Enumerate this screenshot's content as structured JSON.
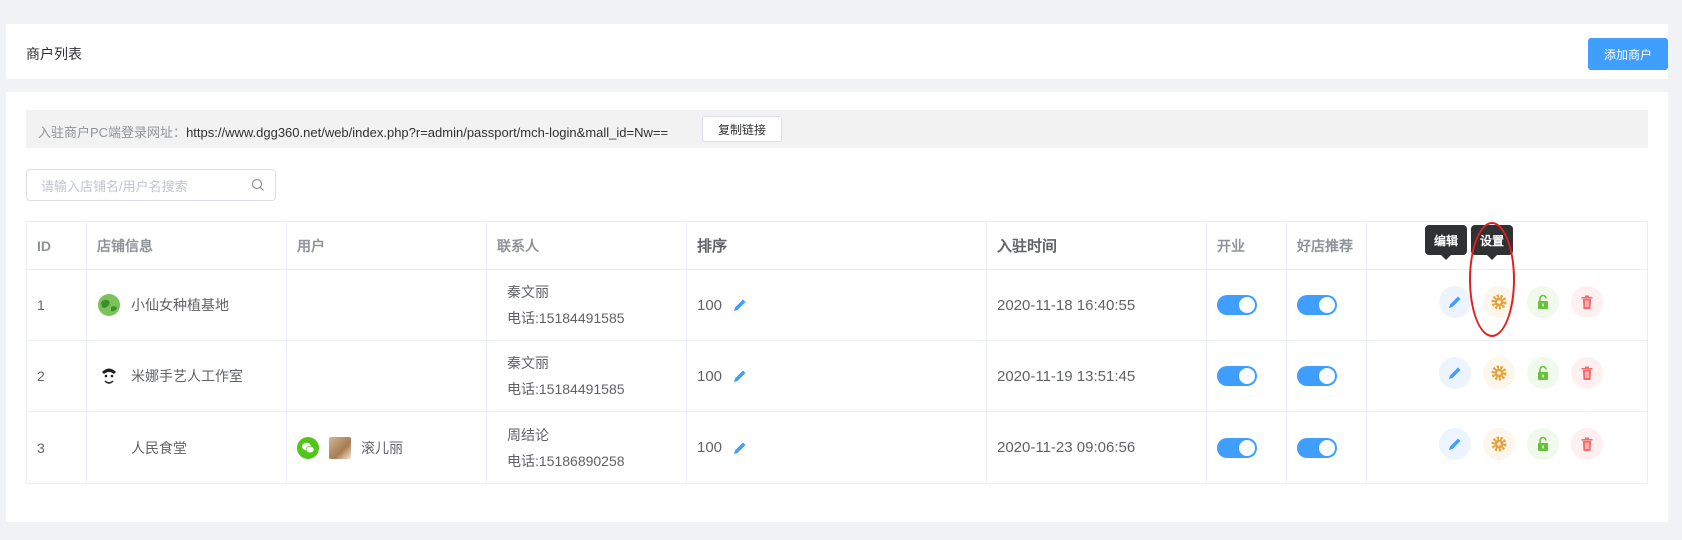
{
  "header": {
    "title": "商户列表",
    "add_button": "添加商户"
  },
  "login_url": {
    "label": "入驻商户PC端登录网址：",
    "url": "https://www.dgg360.net/web/index.php?r=admin/passport/mch-login&mall_id=Nw==",
    "copy_button": "复制链接"
  },
  "search": {
    "placeholder": "请输入店铺名/用户名搜索"
  },
  "table": {
    "columns": [
      "ID",
      "店铺信息",
      "用户",
      "联系人",
      "排序",
      "入驻时间",
      "开业",
      "好店推荐"
    ],
    "rows": [
      {
        "id": "1",
        "store": "小仙女种植基地",
        "user": "",
        "contact_name": "秦文丽",
        "contact_phone": "电话:15184491585",
        "sort": "100",
        "time": "2020-11-18 16:40:55",
        "open": true,
        "recommend": true
      },
      {
        "id": "2",
        "store": "米娜手艺人工作室",
        "user": "",
        "contact_name": "秦文丽",
        "contact_phone": "电话:15184491585",
        "sort": "100",
        "time": "2020-11-19 13:51:45",
        "open": true,
        "recommend": true
      },
      {
        "id": "3",
        "store": "人民食堂",
        "user": "滚儿丽",
        "contact_name": "周结论",
        "contact_phone": "电话:15186890258",
        "sort": "100",
        "time": "2020-11-23 09:06:56",
        "open": true,
        "recommend": true
      }
    ]
  },
  "tooltips": {
    "edit": "编辑",
    "settings": "设置"
  },
  "colors": {
    "primary": "#409eff",
    "warning": "#e6a23c",
    "success": "#67c23a",
    "danger": "#f56c6c",
    "annotation_circle": "#e02020"
  }
}
